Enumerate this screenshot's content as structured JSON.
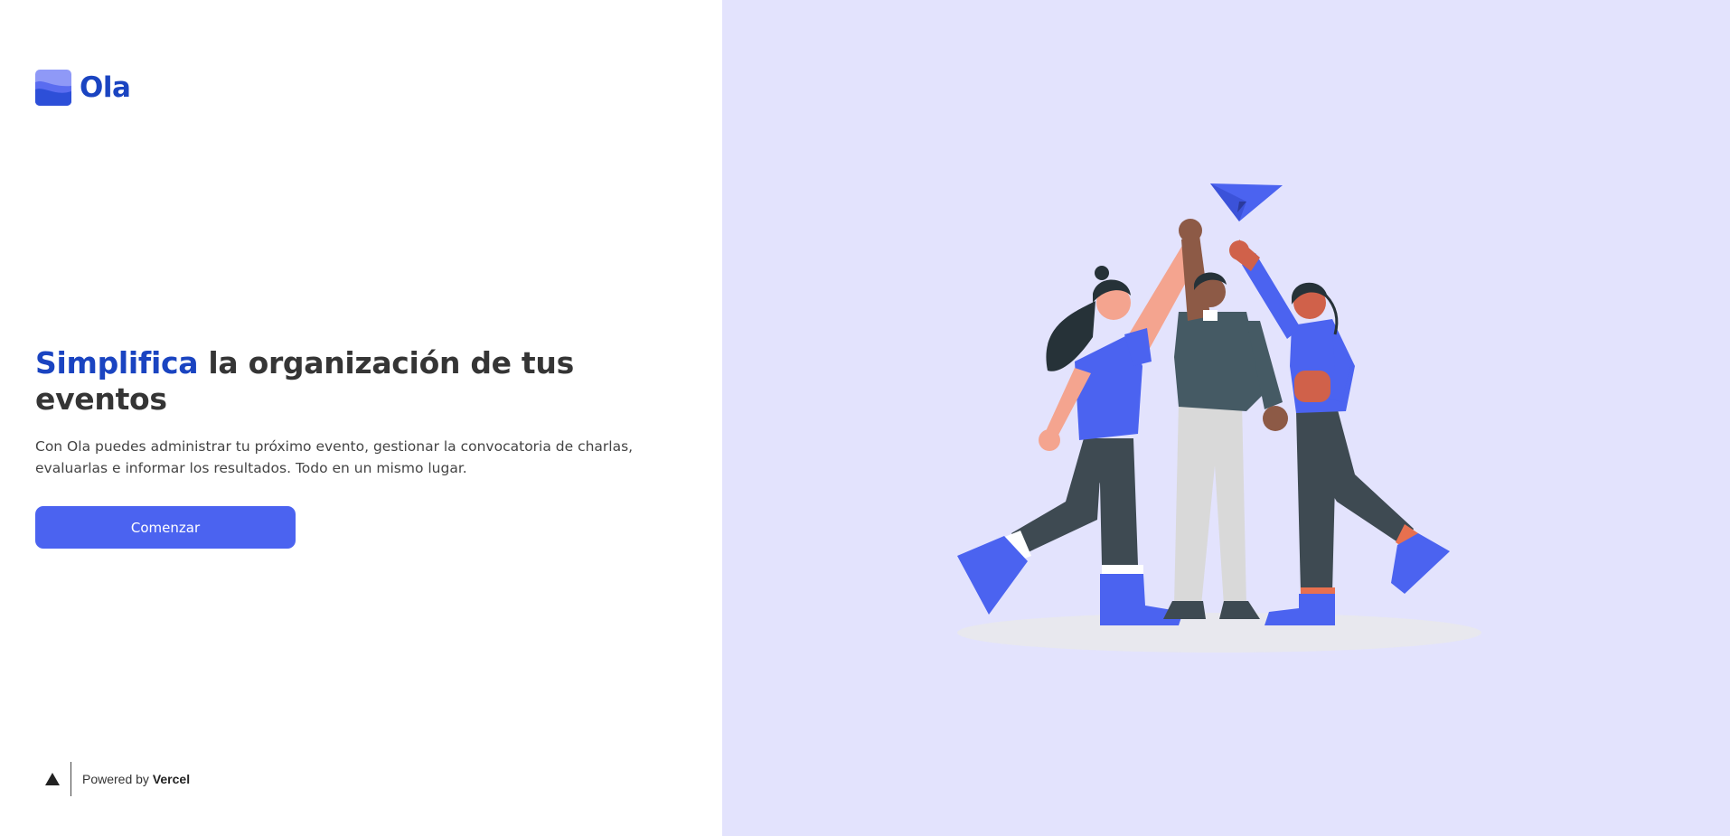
{
  "brand": {
    "name": "Ola",
    "logo_icon": "wave-logo-icon",
    "color": "#1a44c1"
  },
  "hero": {
    "headline_accent": "Simplifica",
    "headline_rest": " la organización de tus eventos",
    "description": "Con Ola puedes administrar tu próximo evento, gestionar la convocatoria de charlas, evaluarlas e informar los resultados. Todo en un mismo lugar.",
    "cta_label": "Comenzar",
    "accent_color": "#4b63f0"
  },
  "footer": {
    "powered_prefix": "Powered by ",
    "powered_brand": "Vercel",
    "icon": "vercel-triangle-icon"
  },
  "illustration": {
    "icon": "team-high-five-illustration",
    "background": "#e3e3fd"
  }
}
